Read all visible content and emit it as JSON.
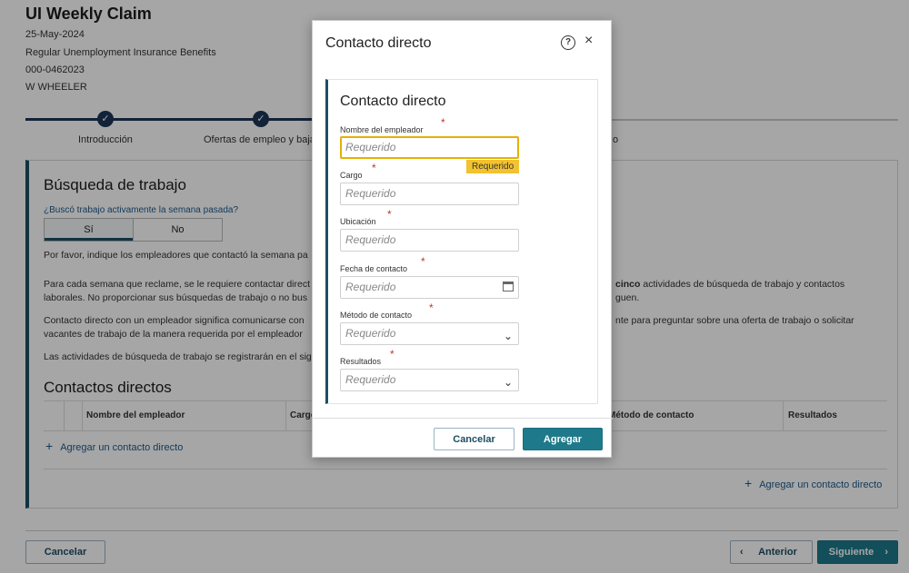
{
  "claim": {
    "title": "UI Weekly Claim",
    "date": "25-May-2024",
    "program": "Regular Unemployment Insurance Benefits",
    "claim_id": "000-0462023",
    "name": "W  WHEELER"
  },
  "stepper": {
    "steps": [
      {
        "label": "Introducción",
        "done_icon": "✓"
      },
      {
        "label": "Ofertas de empleo y baja",
        "done_icon": "✓"
      }
    ],
    "hidden_step_tail": "o"
  },
  "work_search": {
    "title": "Búsqueda de trabajo",
    "question": "¿Buscó trabajo activamente la semana pasada?",
    "options": [
      "Sí",
      "No"
    ],
    "selected": "Sí",
    "paragraphs": [
      "Por favor, indique los empleadores que contactó la semana pa",
      "Para cada semana que reclame, se le requiere contactar direct",
      "laborales. No proporcionar sus búsquedas de trabajo o no bus",
      "Contacto directo con un empleador significa comunicarse con",
      "vacantes de trabajo de la manera requerida por el empleador",
      "Las actividades de búsqueda de trabajo se registrarán en el sig"
    ],
    "right_fragments": {
      "line1_bold": "cinco",
      "line1": " actividades de búsqueda de trabajo y contactos",
      "line2": "guen.",
      "line3": "nte para preguntar sobre una oferta de trabajo o solicitar"
    }
  },
  "direct_contacts": {
    "title": "Contactos directos",
    "columns": [
      "Nombre del empleador",
      "Cargo",
      "Método de contacto",
      "Resultados"
    ],
    "add_label": "Agregar un contacto directo",
    "add_label_bottom": "Agregar un contacto directo"
  },
  "footer": {
    "cancel": "Cancelar",
    "previous": "Anterior",
    "next": "Siguiente"
  },
  "modal": {
    "title": "Contacto directo",
    "help_icon": "?",
    "close_icon": "×",
    "panel_title": "Contacto directo",
    "fields": [
      {
        "label": "Nombre del empleador",
        "placeholder": "Requerido"
      },
      {
        "label": "Cargo",
        "placeholder": "Requerido"
      },
      {
        "label": "Ubicación",
        "placeholder": "Requerido"
      },
      {
        "label": "Fecha de contacto",
        "placeholder": "Requerido"
      },
      {
        "label": "Método de contacto",
        "placeholder": "Requerido"
      },
      {
        "label": "Resultados",
        "placeholder": "Requerido"
      }
    ],
    "tooltip": "Requerido",
    "cancel": "Cancelar",
    "add": "Agregar"
  }
}
